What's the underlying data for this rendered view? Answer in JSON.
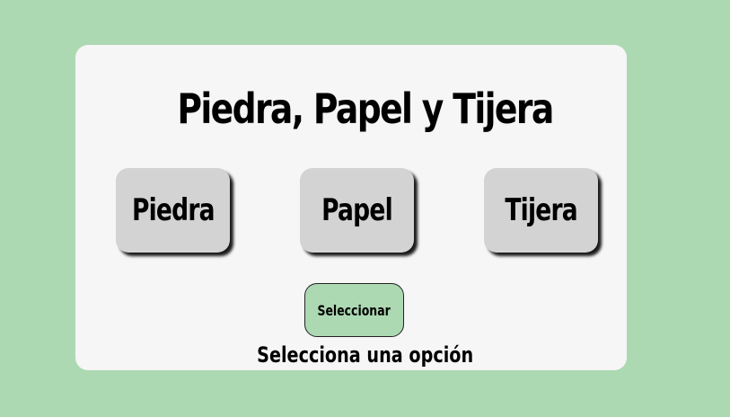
{
  "app": {
    "title": "Piedra, Papel y Tijera"
  },
  "choices": [
    {
      "label": "Piedra"
    },
    {
      "label": "Papel"
    },
    {
      "label": "Tijera"
    }
  ],
  "actions": {
    "select_label": "Seleccionar"
  },
  "status": {
    "message": "Selecciona una opción"
  },
  "colors": {
    "background": "#acd9b2",
    "card": "#f6f6f6",
    "choice_button": "#d3d3d3",
    "select_button": "#acd9b2"
  }
}
